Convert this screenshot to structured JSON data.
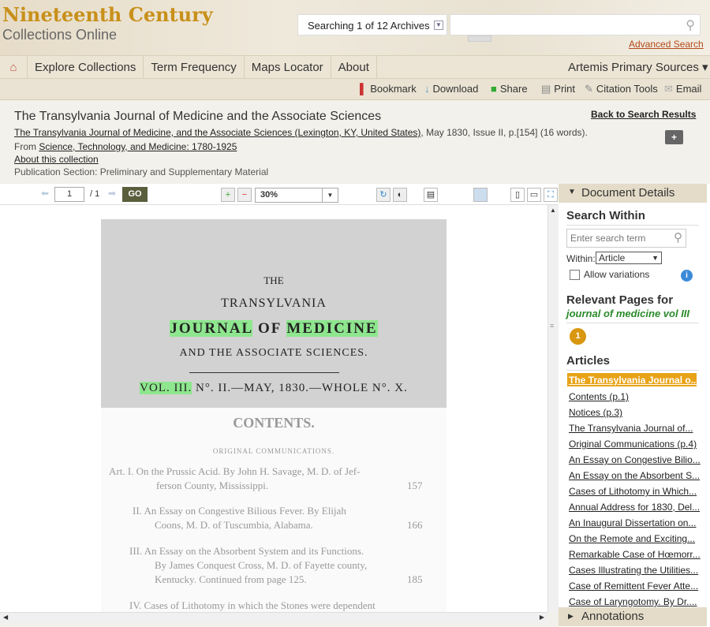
{
  "header": {
    "logo_line1": "Nineteenth Century",
    "logo_line2": "Collections Online",
    "archive_selector": "Searching 1 of 12 Archives",
    "search_placeholder": "",
    "advanced_search": "Advanced Search"
  },
  "nav": {
    "items": [
      "Explore Collections",
      "Term Frequency",
      "Maps Locator",
      "About"
    ],
    "product": "Artemis Primary Sources ▾"
  },
  "tools": [
    "Bookmark",
    "Download",
    "Share",
    "Print",
    "Citation Tools",
    "Email"
  ],
  "doc": {
    "title": "The Transylvania Journal of Medicine and the Associate Sciences",
    "source_link": "The Transylvania Journal of Medicine, and the Associate Sciences (Lexington, KY, United States)",
    "source_rest": ", May 1830, Issue II, p.[154] (16 words).",
    "from_label": "From",
    "collection_link": "Science, Technology, and Medicine: 1780-1925",
    "about": "About this collection",
    "section": "Publication Section: Preliminary and Supplementary Material",
    "back": "Back to Search Results"
  },
  "viewer": {
    "page": "1",
    "page_total": "/ 1",
    "go": "GO",
    "zoom": "30%"
  },
  "page_text": {
    "the": "THE",
    "transylvania": "TRANSYLVANIA",
    "journal": "JOURNAL",
    "of": "OF",
    "medicine": "MEDICINE",
    "assoc": "AND THE ASSOCIATE SCIENCES.",
    "vol": "VOL. III.",
    "vol_rest": "N°. II.—MAY, 1830.—WHOLE N°. X.",
    "contents": "CONTENTS.",
    "orig": "ORIGINAL COMMUNICATIONS.",
    "toc1a": "Art. I. On the Prussic Acid.  By John H. Savage, M. D. of Jef-",
    "toc1b": "ferson County, Mississippi.",
    "toc1p": "157",
    "toc2a": "II. An Essay on Congestive Bilious Fever.  By Elijah",
    "toc2b": "Coons, M. D. of Tuscumbia, Alabama.",
    "toc2p": "166",
    "toc3a": "III. An Essay on the Absorbent System and its Functions.",
    "toc3b": "By James Conquest Cross, M. D. of Fayette county,",
    "toc3c": "Kentucky.  Continued from page 125.",
    "toc3p": "185",
    "toc4a": "IV. Cases of Lithotomy in which the Stones were dependent"
  },
  "panel": {
    "details": "Document Details",
    "search_within": "Search Within",
    "search_placeholder": "Enter search term",
    "within_label": "Within:",
    "within_value": "Article",
    "allow_variations": "Allow variations",
    "relevant": "Relevant Pages for",
    "query": "journal of medicine vol III",
    "page_badge": "1",
    "articles_title": "Articles",
    "articles": [
      "The Transylvania Journal o...",
      "Contents (p.1)",
      "Notices (p.3)",
      "The Transylvania Journal of...",
      "Original Communications (p.4)",
      "An Essay on Congestive Bilio...",
      "An Essay on the Absorbent S...",
      "Cases of Lithotomy in Which...",
      "Annual Address for 1830, Del...",
      "An Inaugural Dissertation on...",
      "On the Remote and Exciting...",
      "Remarkable Case of Hœmorr...",
      "Cases Illustrating the Utilities...",
      "Case of Remittent Fever Atte...",
      "Case of Laryngotomy. By Dr...."
    ],
    "annotations": "Annotations"
  },
  "colors": {
    "brand": "#c8901a",
    "highlight": "#8ee68e",
    "active_article": "#e8a317"
  }
}
